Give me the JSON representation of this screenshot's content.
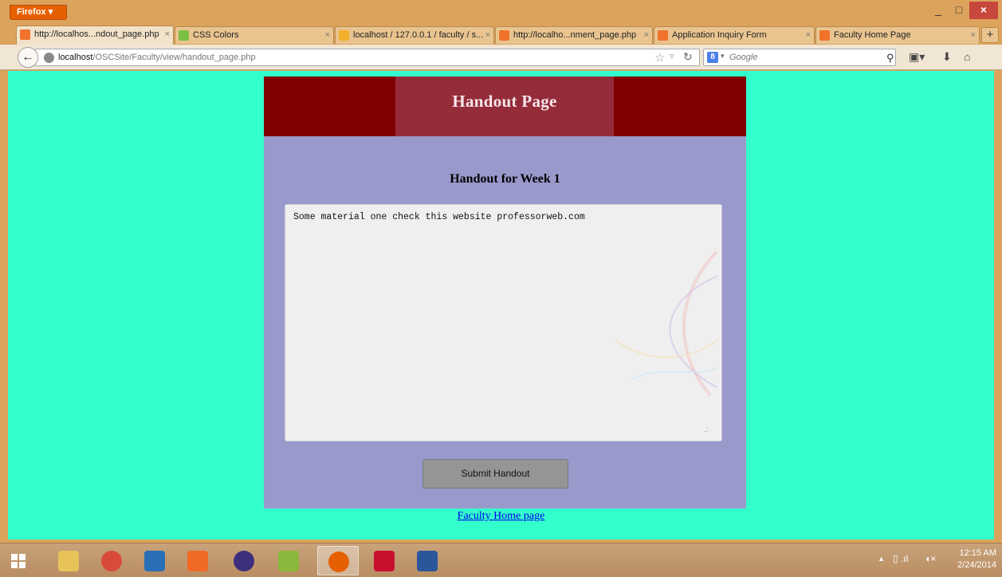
{
  "browser": {
    "app_button": "Firefox",
    "window_controls": {
      "minimize": "_",
      "maximize": "□",
      "close": "×"
    },
    "tabs": [
      {
        "label": "http://localhos...ndout_page.php",
        "close": "×",
        "active": true,
        "icon": "xampp-icon"
      },
      {
        "label": "CSS Colors",
        "close": "×",
        "active": false,
        "icon": "w3c-icon"
      },
      {
        "label": "localhost / 127.0.0.1 / faculty / s...",
        "close": "×",
        "active": false,
        "icon": "phpmyadmin-icon"
      },
      {
        "label": "http://localho...nment_page.php",
        "close": "×",
        "active": false,
        "icon": "xampp-icon"
      },
      {
        "label": "Application Inquiry Form",
        "close": "×",
        "active": false,
        "icon": "xampp-icon"
      },
      {
        "label": "Faculty Home Page",
        "close": "×",
        "active": false,
        "icon": "xampp-icon"
      }
    ],
    "new_tab": "+",
    "url": {
      "host": "localhost",
      "path": "/OSCSite/Faculty/view/handout_page.php"
    },
    "search": {
      "placeholder": "Google",
      "engine_badge": "8"
    }
  },
  "page": {
    "header_title": "Handout Page",
    "heading": "Handout for Week 1",
    "textarea_value": "Some material one check this website professorweb.com",
    "submit_label": "Submit Handout",
    "footer_link": "Faculty Home page",
    "colors": {
      "background": "#33ffcc",
      "panel": "#9999cc",
      "header": "#800000",
      "title_box": "#952c3a"
    }
  },
  "taskbar": {
    "apps": [
      "file-explorer-icon",
      "chrome-icon",
      "virtualbox-icon",
      "xampp-icon",
      "eclipse-icon",
      "android-sdk-icon",
      "firefox-icon",
      "acrobat-icon",
      "word-icon"
    ],
    "clock_time": "12:15 AM",
    "clock_date": "2/24/2014"
  }
}
